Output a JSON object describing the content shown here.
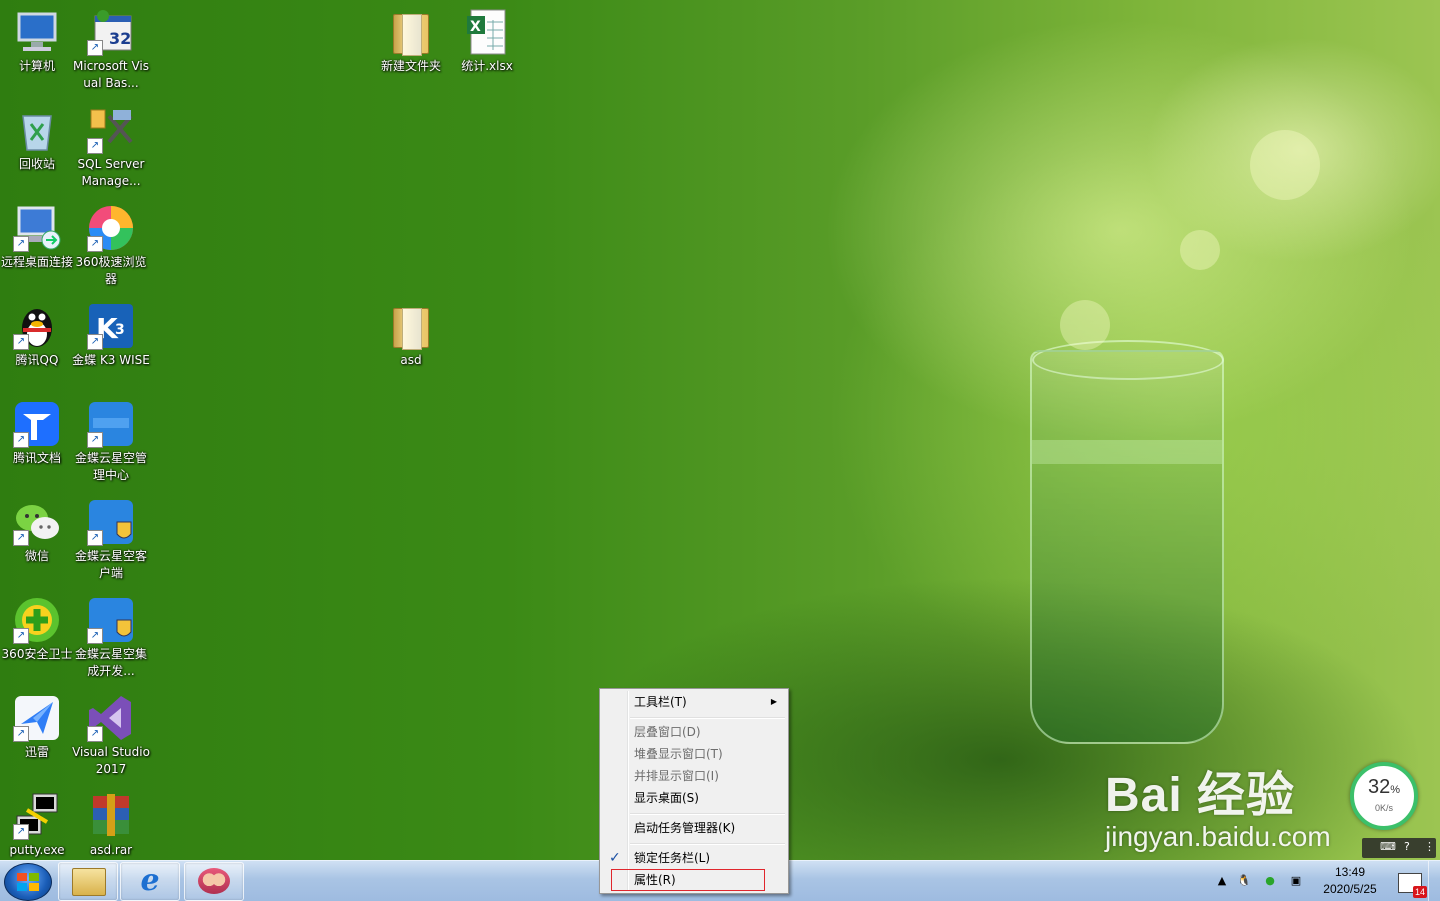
{
  "desktop_icons": {
    "computer": "计算机",
    "vb": "Microsoft Visual Bas...",
    "recycle": "回收站",
    "sql": "SQL Server Manage...",
    "rdp": "远程桌面连接",
    "browser360": "360极速浏览器",
    "qq": "腾讯QQ",
    "k3": "金蝶 K3 WISE",
    "tdocs": "腾讯文档",
    "kd_admin": "金蝶云星空管理中心",
    "wechat": "微信",
    "kd_client": "金蝶云星空客户端",
    "safe360": "360安全卫士",
    "kd_dev": "金蝶云星空集成开发...",
    "xunlei": "迅雷",
    "vs": "Visual Studio 2017",
    "putty": "putty.exe",
    "rar": "asd.rar",
    "new_folder": "新建文件夹",
    "xlsx": "统计.xlsx",
    "asd": "asd"
  },
  "icon_badges": {
    "vb": "32"
  },
  "context_menu": {
    "toolbars": "工具栏(T)",
    "cascade": "层叠窗口(D)",
    "stack": "堆叠显示窗口(T)",
    "side_by_side": "并排显示窗口(I)",
    "show_desktop": "显示桌面(S)",
    "task_manager": "启动任务管理器(K)",
    "lock_taskbar": "锁定任务栏(L)",
    "properties": "属性(R)"
  },
  "watermark": {
    "brand": "Bai 经验",
    "url": "jingyan.baidu.com"
  },
  "net_widget": {
    "percent": "32",
    "percent_unit": "%",
    "speed": "0K/s"
  },
  "clock": {
    "time": "13:49",
    "date": "2020/5/25"
  },
  "action_center_badge": "14",
  "colors": {
    "menu_highlight_border": "#e0262d",
    "taskbar": "#a9c4e4",
    "desktop_green": "#3b8a16"
  }
}
